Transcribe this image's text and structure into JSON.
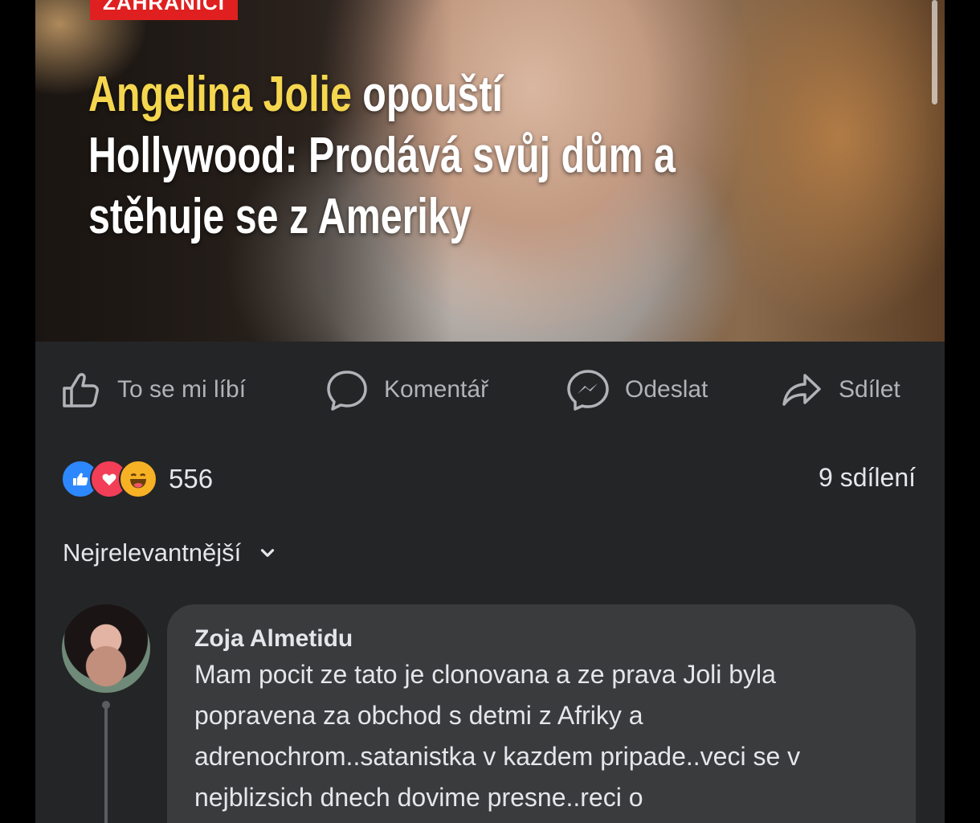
{
  "post": {
    "section_tag": "ZAHRANIČÍ",
    "headline_highlight": "Angelina Jolie",
    "headline_rest": " opouští Hollywood: Prodává svůj dům a stěhuje se z Ameriky"
  },
  "actions": {
    "like_label": "To se mi líbí",
    "comment_label": "Komentář",
    "send_label": "Odeslat",
    "share_label": "Sdílet"
  },
  "reactions": {
    "count": "556",
    "shares": "9 sdílení",
    "types": [
      "like",
      "love",
      "haha"
    ]
  },
  "sort": {
    "label": "Nejrelevantnější"
  },
  "comment": {
    "author": "Zoja Almetidu",
    "text": "Mam pocit ze tato je clonovana a ze prava Joli byla popravena za obchod s detmi z Afriky a adrenochrom..satanistka v kazdem pripade..veci se v nejblizsich dnech dovime presne..reci o"
  },
  "colors": {
    "background": "#242526",
    "headline_highlight": "#f5d64f",
    "tag_red": "#e02020",
    "like_blue": "#2d88ff",
    "love_red": "#f33e58",
    "haha_yellow": "#f7b125",
    "comment_bubble": "#3a3b3c"
  }
}
